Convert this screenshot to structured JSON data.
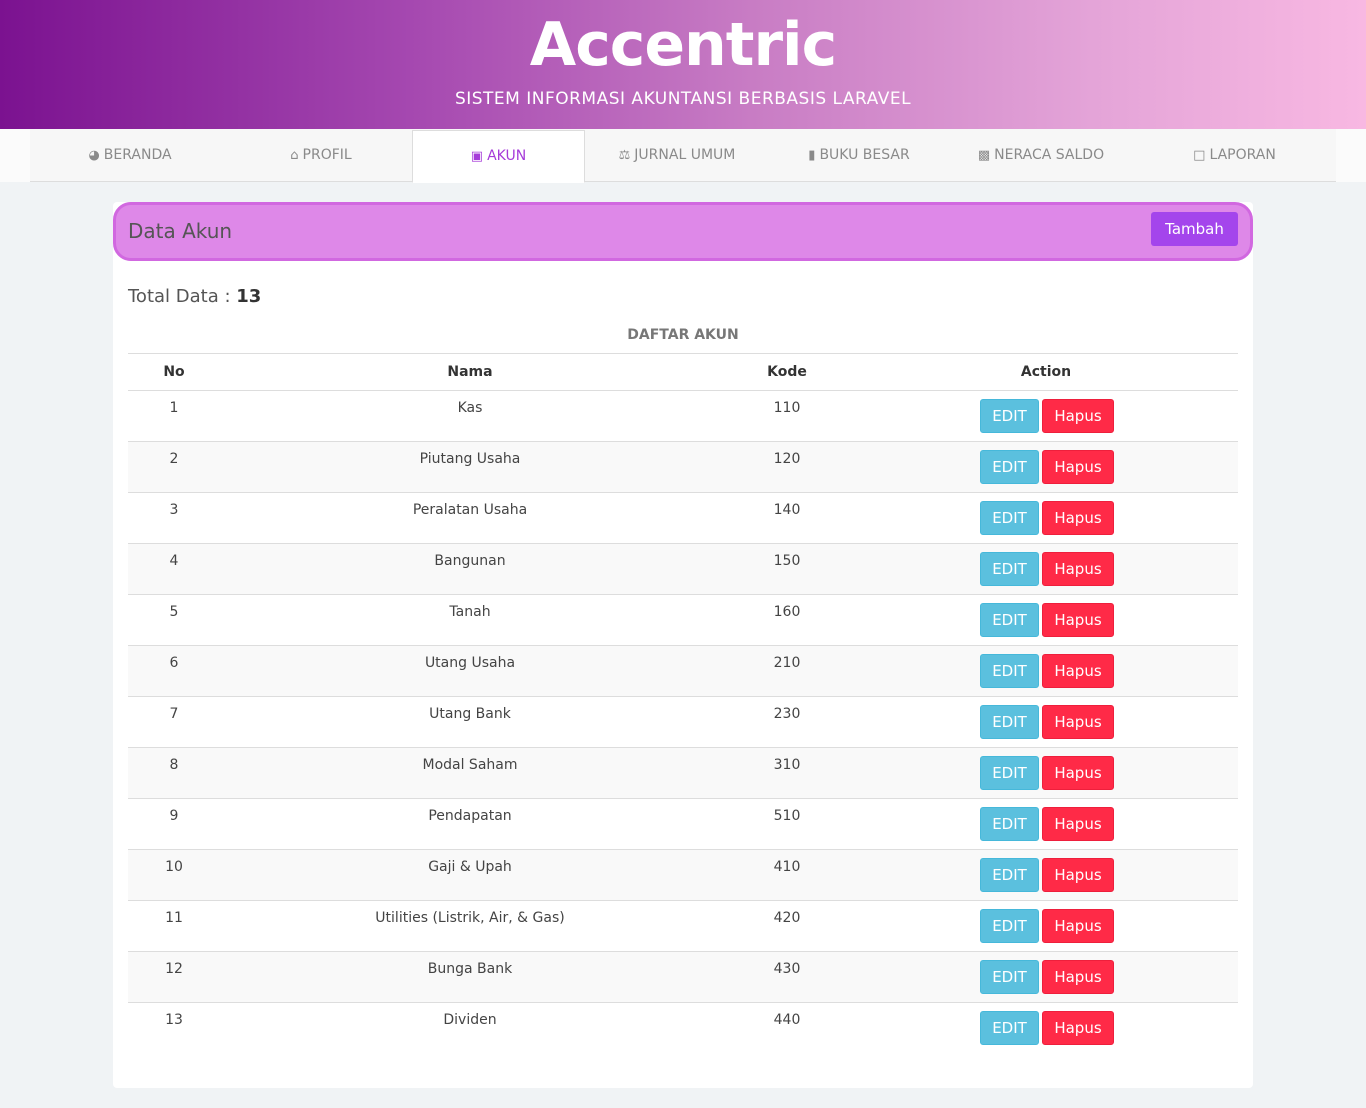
{
  "header": {
    "brand": "Accentric",
    "tagline": "SISTEM INFORMASI AKUNTANSI BERBASIS LARAVEL"
  },
  "nav": {
    "tabs": [
      {
        "label": "BERANDA",
        "icon": "dashboard-icon"
      },
      {
        "label": "PROFIL",
        "icon": "bank-icon"
      },
      {
        "label": "AKUN",
        "icon": "address-book-icon"
      },
      {
        "label": "JURNAL UMUM",
        "icon": "balance-scale-icon"
      },
      {
        "label": "BUKU BESAR",
        "icon": "book-icon"
      },
      {
        "label": "NERACA SALDO",
        "icon": "money-icon"
      },
      {
        "label": "LAPORAN",
        "icon": "file-pdf-icon"
      }
    ],
    "active_tab": "AKUN"
  },
  "card": {
    "title": "Data Akun",
    "add_label": "Tambah",
    "total_label": "Total Data :",
    "total_value": "13",
    "caption": "DAFTAR AKUN"
  },
  "table": {
    "headers": {
      "no": "No",
      "nama": "Nama",
      "kode": "Kode",
      "action": "Action"
    },
    "edit_label": "EDIT",
    "delete_label": "Hapus",
    "rows": [
      {
        "no": "1",
        "nama": "Kas",
        "kode": "110"
      },
      {
        "no": "2",
        "nama": "Piutang Usaha",
        "kode": "120"
      },
      {
        "no": "3",
        "nama": "Peralatan Usaha",
        "kode": "140"
      },
      {
        "no": "4",
        "nama": "Bangunan",
        "kode": "150"
      },
      {
        "no": "5",
        "nama": "Tanah",
        "kode": "160"
      },
      {
        "no": "6",
        "nama": "Utang Usaha",
        "kode": "210"
      },
      {
        "no": "7",
        "nama": "Utang Bank",
        "kode": "230"
      },
      {
        "no": "8",
        "nama": "Modal Saham",
        "kode": "310"
      },
      {
        "no": "9",
        "nama": "Pendapatan",
        "kode": "510"
      },
      {
        "no": "10",
        "nama": "Gaji & Upah",
        "kode": "410"
      },
      {
        "no": "11",
        "nama": "Utilities (Listrik, Air, & Gas)",
        "kode": "420"
      },
      {
        "no": "12",
        "nama": "Bunga Bank",
        "kode": "430"
      },
      {
        "no": "13",
        "nama": "Dividen",
        "kode": "440"
      }
    ]
  },
  "colors": {
    "accent": "#a445ec",
    "edit": "#5bc0de",
    "delete": "#ff2a47",
    "card_head": "#de88e8"
  }
}
